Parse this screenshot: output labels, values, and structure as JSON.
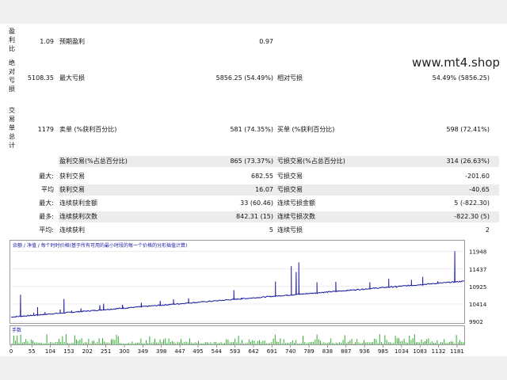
{
  "watermark": "www.mt4.shop",
  "left_vertical_labels": [
    "盈利比",
    "绝对亏损",
    "交易单总计"
  ],
  "stats": {
    "row1": {
      "value1": "1.09",
      "label1": "预期盈利",
      "value2": "0.97"
    },
    "row2": {
      "value1": "5108.35",
      "label1": "最大亏损",
      "value2": "5856.25 (54.49%)",
      "label2": "相对亏损",
      "value3": "54.49% (5856.25)"
    },
    "row3": {
      "value1": "1179",
      "label1": "卖单 (%获利百分比)",
      "value2": "581 (74.35%)",
      "label2": "买单 (%获利百分比)",
      "value3": "598 (72.41%)"
    },
    "row4": {
      "label1": "盈利交易(%占总百分比)",
      "value2": "865 (73.37%)",
      "label2": "亏损交易(%占总百分比)",
      "value3": "314 (26.63%)"
    },
    "row5": {
      "prefix": "最大:",
      "label1": "获利交易",
      "value2": "682.55",
      "label2": "亏损交易",
      "value3": "-201.60"
    },
    "row6": {
      "prefix": "平均",
      "label1": "获利交易",
      "value2": "16.07",
      "label2": "亏损交易",
      "value3": "-40.65"
    },
    "row7": {
      "prefix": "最大:",
      "label1": "连续获利金额",
      "value2": "33 (60.46)",
      "label2": "连续亏损金额",
      "value3": "5 (-822.30)"
    },
    "row8": {
      "prefix": "最多:",
      "label1": "连续获利次数",
      "value2": "842.31 (15)",
      "label2": "连续亏损次数",
      "value3": "-822.30 (5)"
    },
    "row9": {
      "prefix": "平均:",
      "label1": "连续获利",
      "value2": "5",
      "label2": "连续亏损",
      "value3": "2"
    }
  },
  "chart_legend": "余额 / 净值 / 每个时时价格(基于所有可用的最小时段的每一个价格的分形插值计算)",
  "volume_label": "手数",
  "chart_data": {
    "type": "line",
    "series": [
      {
        "name": "余额",
        "color": "#1a1aa0"
      }
    ],
    "y_ticks": [
      9902,
      10414,
      10925,
      11437,
      11948
    ],
    "ylim": [
      9902,
      12150
    ],
    "x_ticks": [
      0,
      55,
      104,
      153,
      202,
      251,
      300,
      349,
      398,
      447,
      495,
      544,
      593,
      642,
      691,
      740,
      789,
      838,
      887,
      936,
      985,
      1034,
      1083,
      1132,
      1181
    ],
    "xlim": [
      0,
      1200
    ],
    "trend_start": 10030,
    "trend_end": 11080,
    "spikes": [
      {
        "x": 25,
        "y": 10680
      },
      {
        "x": 60,
        "y": 10160
      },
      {
        "x": 70,
        "y": 10320
      },
      {
        "x": 90,
        "y": 10180
      },
      {
        "x": 130,
        "y": 10250
      },
      {
        "x": 140,
        "y": 10560
      },
      {
        "x": 185,
        "y": 10280
      },
      {
        "x": 235,
        "y": 10380
      },
      {
        "x": 245,
        "y": 10420
      },
      {
        "x": 295,
        "y": 10390
      },
      {
        "x": 345,
        "y": 10450
      },
      {
        "x": 395,
        "y": 10500
      },
      {
        "x": 430,
        "y": 10550
      },
      {
        "x": 470,
        "y": 10580
      },
      {
        "x": 590,
        "y": 10820
      },
      {
        "x": 700,
        "y": 11070
      },
      {
        "x": 742,
        "y": 11520
      },
      {
        "x": 755,
        "y": 11350
      },
      {
        "x": 762,
        "y": 11630
      },
      {
        "x": 810,
        "y": 11050
      },
      {
        "x": 860,
        "y": 11060
      },
      {
        "x": 950,
        "y": 11050
      },
      {
        "x": 1000,
        "y": 11150
      },
      {
        "x": 1060,
        "y": 11120
      },
      {
        "x": 1090,
        "y": 11210
      },
      {
        "x": 1130,
        "y": 11080
      },
      {
        "x": 1175,
        "y": 11960
      }
    ],
    "dips": [
      {
        "x": 160,
        "y": 10220
      },
      {
        "x": 610,
        "y": 10600
      },
      {
        "x": 890,
        "y": 10830
      },
      {
        "x": 1020,
        "y": 10880
      }
    ],
    "colors": {
      "balance": "#1a1aa0",
      "volume": "#1aa01a"
    }
  }
}
